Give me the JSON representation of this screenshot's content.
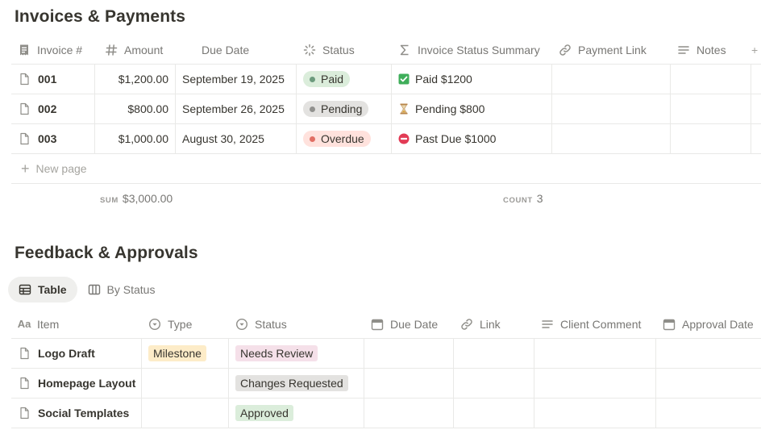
{
  "invoices": {
    "title": "Invoices & Payments",
    "columns": [
      {
        "label": "Invoice #",
        "icon": "receipt-icon"
      },
      {
        "label": "Amount",
        "icon": "hash-icon"
      },
      {
        "label": "Due Date",
        "icon": ""
      },
      {
        "label": "Status",
        "icon": "status-icon"
      },
      {
        "label": "Invoice Status Summary",
        "icon": "sigma-icon"
      },
      {
        "label": "Payment Link",
        "icon": "link-icon"
      },
      {
        "label": "Notes",
        "icon": "text-lines-icon"
      }
    ],
    "rows": [
      {
        "id": "001",
        "amount": "$1,200.00",
        "due": "September 19, 2025",
        "status": "Paid",
        "summary": "Paid $1200",
        "summary_icon": "check-box-icon"
      },
      {
        "id": "002",
        "amount": "$800.00",
        "due": "September 26, 2025",
        "status": "Pending",
        "summary": "Pending $800",
        "summary_icon": "hourglass-icon"
      },
      {
        "id": "003",
        "amount": "$1,000.00",
        "due": "August 30, 2025",
        "status": "Overdue",
        "summary": "Past Due $1000",
        "summary_icon": "no-entry-icon"
      }
    ],
    "new_page": "New page",
    "sum_label": "SUM",
    "sum_value": "$3,000.00",
    "count_label": "COUNT",
    "count_value": "3",
    "status_colors": {
      "Paid": "#dbeddb",
      "Pending": "#e3e2e0",
      "Overdue": "#ffe2dd"
    },
    "status_dots": {
      "Paid": "#6c9b7d",
      "Pending": "#91918e",
      "Overdue": "#e16f64"
    }
  },
  "feedback": {
    "title": "Feedback & Approvals",
    "views": [
      {
        "label": "Table",
        "icon": "table-icon",
        "active": true
      },
      {
        "label": "By Status",
        "icon": "board-icon",
        "active": false
      }
    ],
    "columns": [
      {
        "label": "Item",
        "icon": "text-aa-icon"
      },
      {
        "label": "Type",
        "icon": "select-icon"
      },
      {
        "label": "Status",
        "icon": "select-icon"
      },
      {
        "label": "Due Date",
        "icon": "calendar-icon"
      },
      {
        "label": "Link",
        "icon": "link-icon"
      },
      {
        "label": "Client Comment",
        "icon": "text-lines-icon"
      },
      {
        "label": "Approval Date",
        "icon": "calendar-icon"
      }
    ],
    "rows": [
      {
        "item": "Logo Draft",
        "type": "Milestone",
        "status": "Needs Review"
      },
      {
        "item": "Homepage Layout",
        "type": "",
        "status": "Changes Requested"
      },
      {
        "item": "Social Templates",
        "type": "",
        "status": "Approved"
      }
    ],
    "tag_colors": {
      "Milestone": "#fdecc8",
      "Needs Review": "#f5e0e9",
      "Changes Requested": "#e3e2e0",
      "Approved": "#dbeddb"
    }
  }
}
